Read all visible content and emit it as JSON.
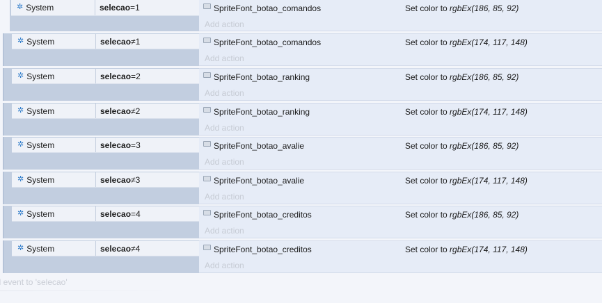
{
  "events": [
    {
      "object": "System",
      "variable": "selecao",
      "operator": "=",
      "value": "1",
      "action_object": "SpriteFont_botao_comandos",
      "action_prefix": "Set color to ",
      "action_fn": "rgbEx(186, 85, 92)",
      "add_action": "Add action"
    },
    {
      "object": "System",
      "variable": "selecao",
      "operator": "≠",
      "value": "1",
      "action_object": "SpriteFont_botao_comandos",
      "action_prefix": "Set color to ",
      "action_fn": "rgbEx(174, 117, 148)",
      "add_action": "Add action"
    },
    {
      "object": "System",
      "variable": "selecao",
      "operator": "=",
      "value": "2",
      "action_object": "SpriteFont_botao_ranking",
      "action_prefix": "Set color to ",
      "action_fn": "rgbEx(186, 85, 92)",
      "add_action": "Add action"
    },
    {
      "object": "System",
      "variable": "selecao",
      "operator": "≠",
      "value": "2",
      "action_object": "SpriteFont_botao_ranking",
      "action_prefix": "Set color to ",
      "action_fn": "rgbEx(174, 117, 148)",
      "add_action": "Add action"
    },
    {
      "object": "System",
      "variable": "selecao",
      "operator": "=",
      "value": "3",
      "action_object": "SpriteFont_botao_avalie",
      "action_prefix": "Set color to ",
      "action_fn": "rgbEx(186, 85, 92)",
      "add_action": "Add action"
    },
    {
      "object": "System",
      "variable": "selecao",
      "operator": "≠",
      "value": "3",
      "action_object": "SpriteFont_botao_avalie",
      "action_prefix": "Set color to ",
      "action_fn": "rgbEx(174, 117, 148)",
      "add_action": "Add action"
    },
    {
      "object": "System",
      "variable": "selecao",
      "operator": "=",
      "value": "4",
      "action_object": "SpriteFont_botao_creditos",
      "action_prefix": "Set color to ",
      "action_fn": "rgbEx(186, 85, 92)",
      "add_action": "Add action"
    },
    {
      "object": "System",
      "variable": "selecao",
      "operator": "≠",
      "value": "4",
      "action_object": "SpriteFont_botao_creditos",
      "action_prefix": "Set color to ",
      "action_fn": "rgbEx(174, 117, 148)",
      "add_action": "Add action"
    }
  ],
  "add_event_label": "ld event to 'selecao'",
  "icons": {
    "system": "gear-icon",
    "sprite": "spritefont-icon"
  },
  "colors": {
    "condition_bg": "#c2cee0",
    "action_bg": "#e6ecf7",
    "gear": "#2c7ac9"
  }
}
